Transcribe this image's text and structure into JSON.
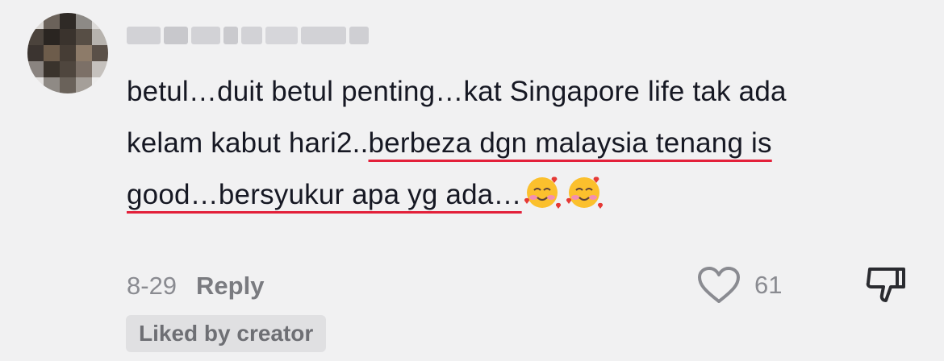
{
  "comment": {
    "part1": "betul…duit betul penting…kat Singapore life tak ada kelam kabut hari2..",
    "part2": "berbeza dgn malaysia tenang is good…bersyukur apa yg ada…",
    "emojis": [
      "smiling-face-with-hearts",
      "smiling-face-with-hearts"
    ]
  },
  "meta": {
    "date": "8-29",
    "reply_label": "Reply",
    "like_count": "61"
  },
  "badge": "Liked by creator",
  "colors": {
    "background": "#f1f1f2",
    "text": "#161823",
    "secondary": "#8a8b91",
    "underline": "#e3203a"
  }
}
